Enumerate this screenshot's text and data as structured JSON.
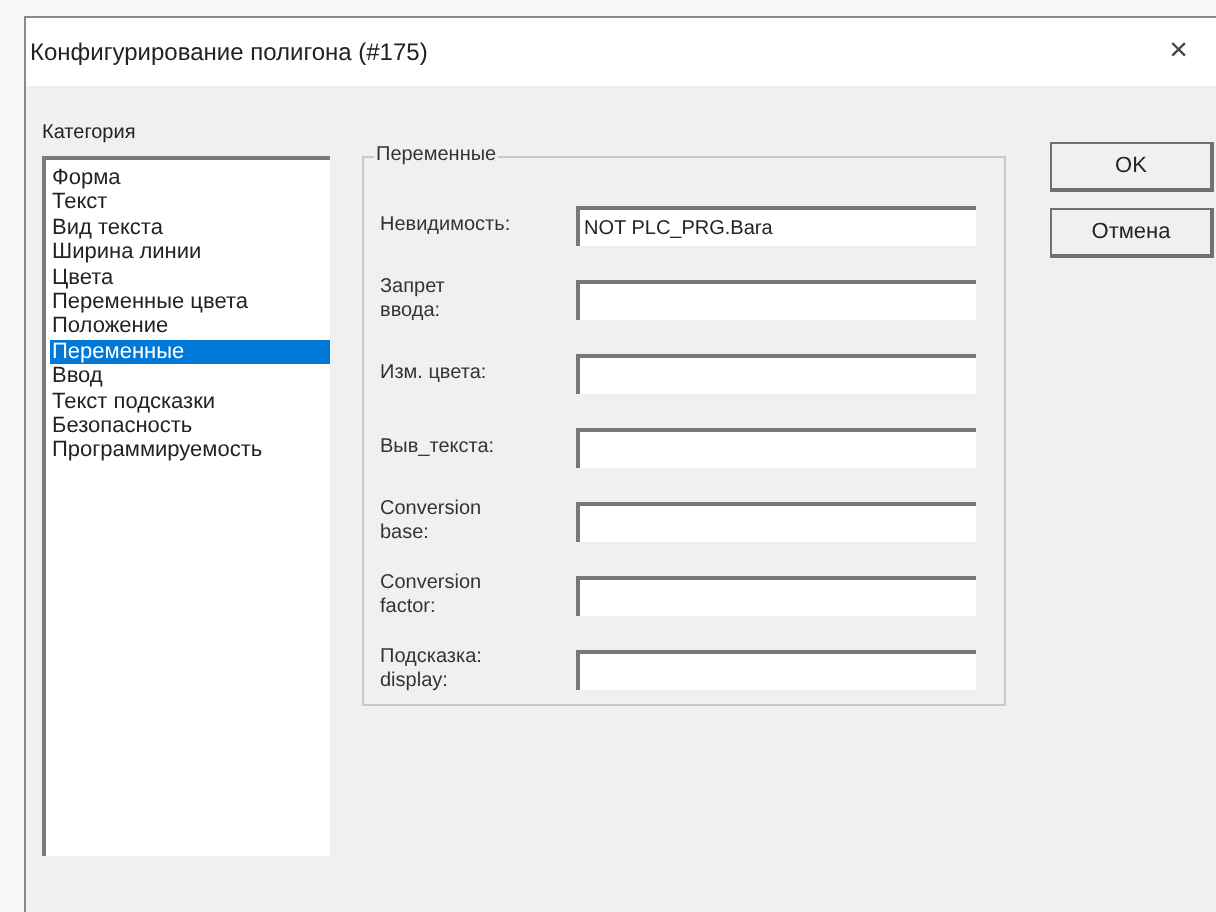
{
  "window": {
    "title": "Конфигурирование полигона (#175)",
    "close": "×"
  },
  "category": {
    "label": "Категория",
    "items": [
      {
        "label": "Форма",
        "selected": false
      },
      {
        "label": "Текст",
        "selected": false
      },
      {
        "label": "Вид текста",
        "selected": false
      },
      {
        "label": "Ширина линии",
        "selected": false
      },
      {
        "label": "Цвета",
        "selected": false
      },
      {
        "label": "Переменные цвета",
        "selected": false
      },
      {
        "label": "Положение",
        "selected": false
      },
      {
        "label": "Переменные",
        "selected": true
      },
      {
        "label": "Ввод",
        "selected": false
      },
      {
        "label": "Текст подсказки",
        "selected": false
      },
      {
        "label": "Безопасность",
        "selected": false
      },
      {
        "label": "Программируемость",
        "selected": false
      }
    ]
  },
  "group": {
    "title": "Переменные",
    "fields": [
      {
        "label": "Невидимость:",
        "value": "NOT PLC_PRG.Bara"
      },
      {
        "label": "Запрет ввода:"
      },
      {
        "label": "Изм. цвета:"
      },
      {
        "label": "Выв_текста:"
      },
      {
        "label": "Conversion base:"
      },
      {
        "label": "Conversion factor:"
      },
      {
        "label": "Подсказка: display:"
      }
    ]
  },
  "buttons": [
    "OK",
    "Отмена"
  ]
}
